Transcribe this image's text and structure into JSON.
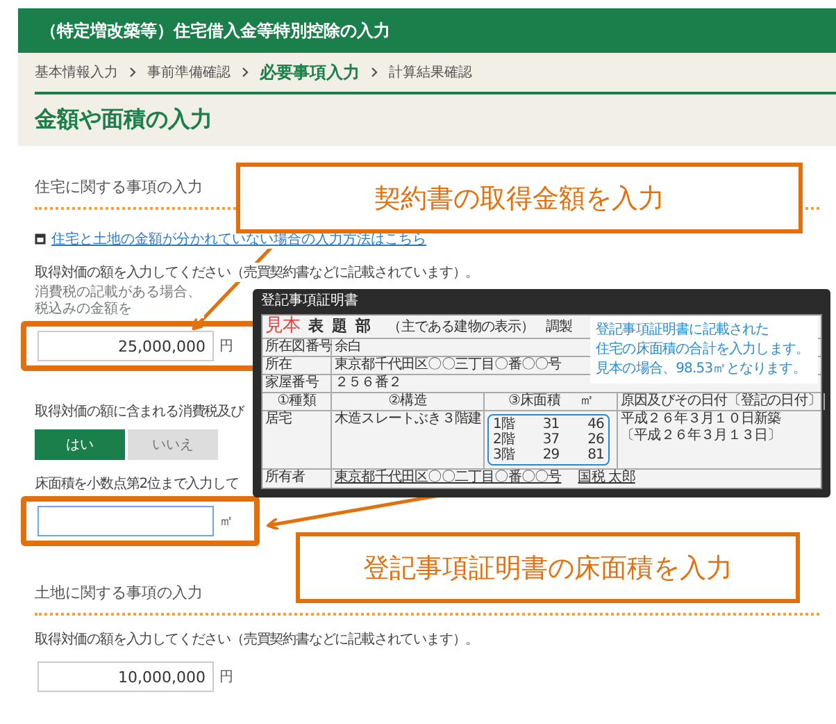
{
  "header": {
    "title": "（特定増改築等）住宅借入金等特別控除の入力"
  },
  "breadcrumb": [
    {
      "label": "基本情報入力",
      "selected": false
    },
    {
      "label": "事前準備確認",
      "selected": false
    },
    {
      "label": "必要事項入力",
      "selected": true
    },
    {
      "label": "計算結果確認",
      "selected": false
    }
  ],
  "page_heading": "金額や面積の入力",
  "sections": [
    {
      "title": "住宅に関する事項の入力",
      "fields": [
        {
          "kind": "link",
          "text": "住宅と土地の金額が分かれていない場合の入力方法はこちら"
        },
        {
          "kind": "amount",
          "label": "取得対価の額を入力してください（売買契約書などに記載されています）。",
          "note": "消費税の記載がある場合、税込みの金額を",
          "value": "25,000,000",
          "unit": "円",
          "highlighted": true,
          "focused": false
        },
        {
          "kind": "choice",
          "label": "取得対価の額に含まれる消費税及び",
          "options": [
            {
              "label": "はい",
              "selected": true
            },
            {
              "label": "いいえ",
              "selected": false
            }
          ]
        },
        {
          "kind": "amount",
          "label": "床面積を小数点第2位まで入力して",
          "unit": "㎡",
          "highlighted": true,
          "focused": true
        }
      ]
    },
    {
      "title": "土地に関する事項の入力",
      "fields": [
        {
          "kind": "amount",
          "label": "取得対価の額を入力してください（売買契約書などに記載されています）。",
          "value": "10,000,000",
          "unit": "円",
          "highlighted": false,
          "focused": false
        }
      ]
    }
  ],
  "callouts": [
    {
      "text": "契約書の取得金額を入力"
    },
    {
      "text": "登記事項証明書の床面積を入力"
    }
  ],
  "popup": {
    "title": "登記事項証明書",
    "document": {
      "stamp": "見本",
      "title": "表題部",
      "subtitle": "（主である建物の表示）",
      "prepared": "調製",
      "info_rows": [
        {
          "label": "所在図番号",
          "value": "余白"
        },
        {
          "label": "所在",
          "value": "東京都千代田区〇〇三丁目〇番〇〇号"
        },
        {
          "label": "家屋番号",
          "value": "２５６番２"
        }
      ],
      "columns": [
        "①種類",
        "②構造",
        "③床面積",
        "原因及びその日付〔登記の日付〕"
      ],
      "area_unit": "㎡",
      "building": {
        "type": "居宅",
        "structure": "木造スレートぶき３階建",
        "floors": [
          {
            "floor": "1階",
            "whole": "31",
            "decimal": "46"
          },
          {
            "floor": "2階",
            "whole": "37",
            "decimal": "26"
          },
          {
            "floor": "3階",
            "whole": "29",
            "decimal": "81"
          }
        ],
        "cause": [
          "平成２６年３月１０日新築",
          "〔平成２６年３月１３日〕"
        ]
      },
      "owner": {
        "label": "所有者",
        "address": "東京都千代田区〇〇二丁目〇番〇〇号",
        "name": "国税 太郎"
      }
    },
    "note": [
      "登記事項証明書に記載された",
      "住宅の床面積の合計を入力します。",
      "見本の場合、98.53㎡となります。"
    ]
  }
}
